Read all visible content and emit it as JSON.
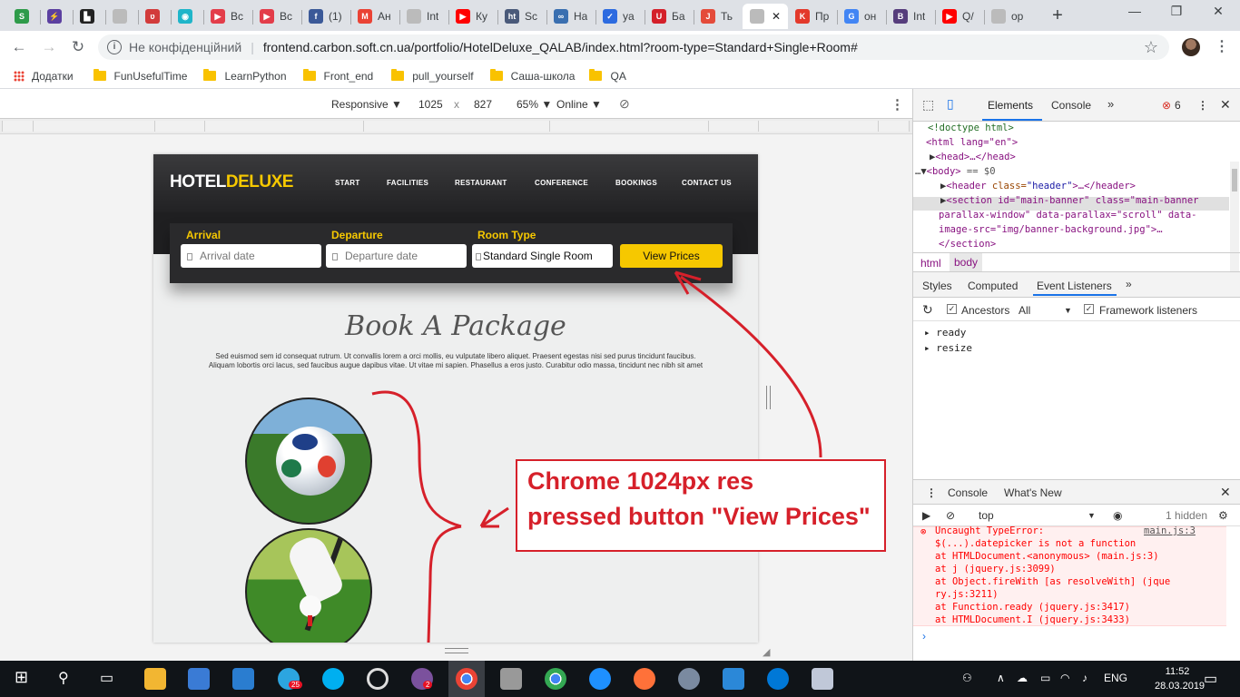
{
  "browser": {
    "tabs": [
      {
        "title": "",
        "fav": "S",
        "color": "#2e9b4a"
      },
      {
        "title": "",
        "fav": "⚡",
        "color": "#5b3fa0"
      },
      {
        "title": "",
        "fav": "▙",
        "color": "#222222"
      },
      {
        "title": "",
        "fav": "",
        "color": "#bbbbbb"
      },
      {
        "title": "",
        "fav": "ʋ",
        "color": "#d23b3b"
      },
      {
        "title": "",
        "fav": "◉",
        "color": "#1fb5c9"
      },
      {
        "title": "Вс",
        "fav": "▶",
        "color": "#e33d4a"
      },
      {
        "title": "Вс",
        "fav": "▶",
        "color": "#e33d4a"
      },
      {
        "title": "(1)",
        "fav": "f",
        "color": "#3b5998"
      },
      {
        "title": "Ан",
        "fav": "M",
        "color": "#ea4335"
      },
      {
        "title": "Int",
        "fav": "",
        "color": "#bbbbbb"
      },
      {
        "title": "Ку",
        "fav": "▶",
        "color": "#ff0000"
      },
      {
        "title": "Sc",
        "fav": "ht",
        "color": "#4a5a7a"
      },
      {
        "title": "На",
        "fav": "∞",
        "color": "#3a6fb0"
      },
      {
        "title": "ya",
        "fav": "✓",
        "color": "#2d6be0"
      },
      {
        "title": "Ба",
        "fav": "U",
        "color": "#d4202a"
      },
      {
        "title": "Ть",
        "fav": "J",
        "color": "#e44b3a"
      },
      {
        "title": "",
        "fav": "",
        "color": "#bbbbbb",
        "active": true
      },
      {
        "title": "Пр",
        "fav": "K",
        "color": "#e3392b"
      },
      {
        "title": "он",
        "fav": "G",
        "color": "#4285f4"
      },
      {
        "title": "Int",
        "fav": "B",
        "color": "#563d7c"
      },
      {
        "title": "Q/",
        "fav": "▶",
        "color": "#ff0000"
      },
      {
        "title": "ор",
        "fav": "",
        "color": "#bbbbbb"
      }
    ],
    "new_tab_label": "+",
    "nav": {
      "back": "←",
      "forward": "→",
      "reload": "↻"
    },
    "address": {
      "info": "i",
      "security": "Не конфіденційний",
      "separator": "|",
      "url": "frontend.carbon.soft.cn.ua/portfolio/HotelDeluxe_QALAB/index.html?room-type=Standard+Single+Room#"
    },
    "bookmarks": [
      "Додатки",
      "FunUsefulTime",
      "LearnPython",
      "Front_end",
      "pull_yourself",
      "Саша-школа",
      "QA"
    ]
  },
  "device_toolbar": {
    "mode": "Responsive ▼",
    "width": "1025",
    "x": "x",
    "height": "827",
    "zoom": "65% ▼",
    "network": "Online ▼"
  },
  "site": {
    "logo_a": "HOTEL",
    "logo_b": "DELUXE",
    "menu": [
      "START",
      "FACILITIES",
      "RESTAURANT",
      "CONFERENCE",
      "BOOKINGS",
      "CONTACT US"
    ],
    "form": {
      "arrival_label": "Arrival",
      "arrival_placeholder": "Arrival date",
      "departure_label": "Departure",
      "departure_placeholder": "Departure date",
      "room_label": "Room Type",
      "room_value": "Standard Single Room",
      "button": "View Prices"
    },
    "package_title": "Book A Package",
    "package_text_1": "Sed euismod sem id consequat rutrum. Ut convallis lorem a orci mollis, eu vulputate libero aliquet. Praesent egestas nisi sed purus tincidunt faucibus.",
    "package_text_2": "Aliquam lobortis orci lacus, sed faucibus augue dapibus vitae. Ut vitae mi sapien. Phasellus a eros justo. Curabitur odio massa, tincidunt nec nibh sit amet"
  },
  "annotation": {
    "line1": "Chrome 1024px res",
    "line2": "pressed button \"View Prices\"",
    "color": "#d6202a"
  },
  "devtools": {
    "tabs": [
      "Elements",
      "Console",
      "»"
    ],
    "error_count": "6",
    "dom": {
      "doctype": "<!doctype html>",
      "html_open": "<html lang=\"en\">",
      "head": "<head>…</head>",
      "body_tag": "<body>",
      "body_sel": " == $0",
      "header_open": "<header ",
      "header_attr": "class=",
      "header_val": "\"header\"",
      "header_rest": ">…</header>",
      "section_l1": "<section id=\"main-banner\" class=\"main-banner",
      "section_l2": "parallax-window\" data-parallax=\"scroll\" data-",
      "section_l3": "image-src=\"img/banner-background.jpg\">…",
      "section_close": "</section>"
    },
    "crumbs": [
      "html",
      "body"
    ],
    "sub_tabs": [
      "Styles",
      "Computed",
      "Event Listeners",
      "»"
    ],
    "ev": {
      "ancestors": "Ancestors",
      "scope": "All",
      "framework": "Framework listeners"
    },
    "listeners": [
      "ready",
      "resize"
    ],
    "drawer_tabs": [
      "Console",
      "What's New"
    ],
    "console_context": "top",
    "hidden": "1 hidden",
    "error_lines": [
      "Uncaught TypeError:",
      "$(...).datepicker is not a function",
      "    at HTMLDocument.<anonymous> (main.js:3)",
      "    at j (jquery.js:3099)",
      "    at Object.fireWith [as resolveWith] (jque",
      "ry.js:3211)",
      "    at Function.ready (jquery.js:3417)",
      "    at HTMLDocument.I (jquery.js:3433)"
    ],
    "error_source": "main.js:3",
    "prompt": "›"
  },
  "taskbar": {
    "language": "ENG",
    "time": "11:52",
    "date": "28.03.2019",
    "telegram_badge": "25",
    "viber_badge": "2"
  }
}
